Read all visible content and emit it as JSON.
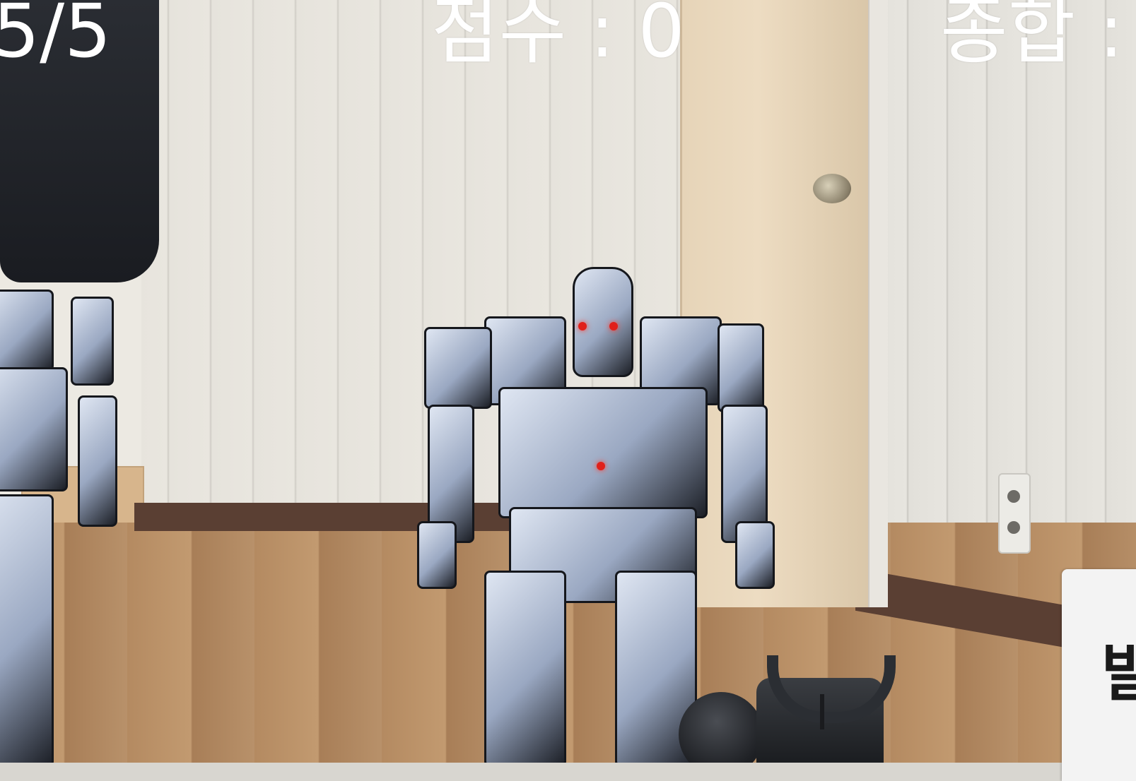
{
  "hud": {
    "ammo_text": "5/5",
    "score_text": "점수 : 0",
    "total_text": "종합 :"
  },
  "side_panel": {
    "label": "발"
  },
  "colors": {
    "hud_text": "#ffffff",
    "robot_eye": "#e0201a",
    "panel_bg": "#f3f3f3"
  }
}
